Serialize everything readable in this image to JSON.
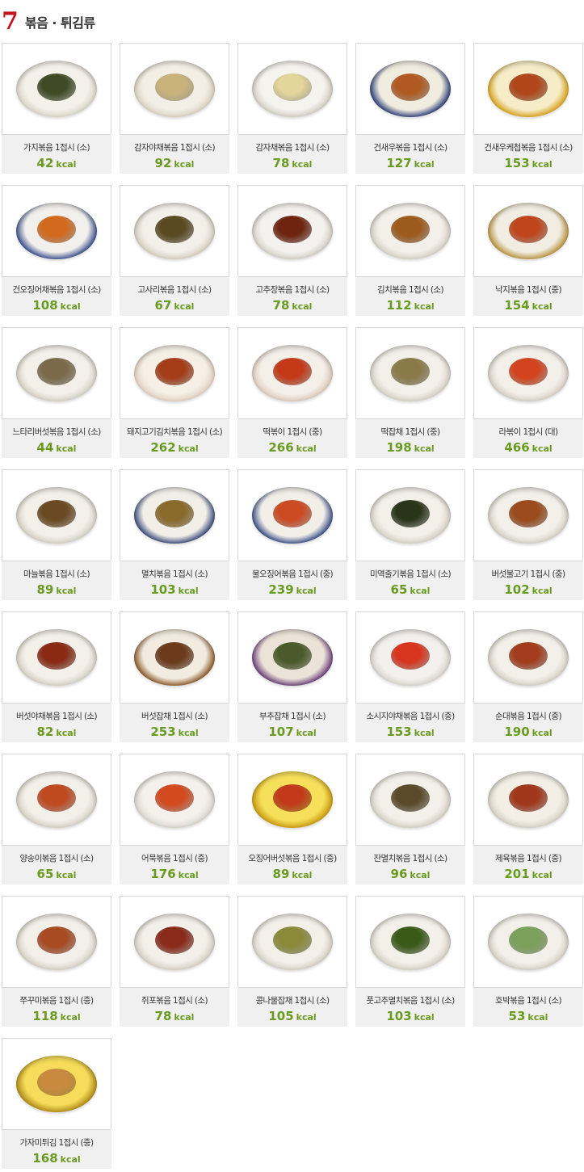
{
  "section": {
    "number": "7",
    "title": "볶음 · 튀김류"
  },
  "unit": "kcal",
  "items": [
    {
      "name": "가지볶음 1접시 (소)",
      "kcal": "42",
      "plate": "#f4f1ea",
      "rim": "#d9d3c6",
      "food": "#3f4a25"
    },
    {
      "name": "감자야채볶음 1접시 (소)",
      "kcal": "92",
      "plate": "#f3efe6",
      "rim": "#d8d0bf",
      "food": "#c9b37a"
    },
    {
      "name": "감자채볶음 1접시 (소)",
      "kcal": "78",
      "plate": "#f5f3ee",
      "rim": "#d2cdc2",
      "food": "#e4d59a"
    },
    {
      "name": "건새우볶음 1접시 (소)",
      "kcal": "127",
      "plate": "#f1ece0",
      "rim": "#2d3f78",
      "food": "#b05a22"
    },
    {
      "name": "건새우케첩볶음 1접시 (소)",
      "kcal": "153",
      "plate": "#f6ecc8",
      "rim": "#d8a21e",
      "food": "#b0461a"
    },
    {
      "name": "건오징어채볶음 1접시 (소)",
      "kcal": "108",
      "plate": "#f2f0ec",
      "rim": "#3a4f8c",
      "food": "#d26a1e"
    },
    {
      "name": "고사리볶음 1접시 (소)",
      "kcal": "67",
      "plate": "#f3f0ea",
      "rim": "#d4cdbf",
      "food": "#5a4a22"
    },
    {
      "name": "고추장볶음 1접시 (소)",
      "kcal": "78",
      "plate": "#f4f2ee",
      "rim": "#d3cec6",
      "food": "#6e2410"
    },
    {
      "name": "김치볶음 1접시 (소)",
      "kcal": "112",
      "plate": "#f3f0ea",
      "rim": "#d5cfc3",
      "food": "#9c5a1c"
    },
    {
      "name": "낙지볶음 1접시 (중)",
      "kcal": "154",
      "plate": "#f2ede2",
      "rim": "#b8933e",
      "food": "#c0451c"
    },
    {
      "name": "느타리버섯볶음 1접시 (소)",
      "kcal": "44",
      "plate": "#f3f0ea",
      "rim": "#d5cfc3",
      "food": "#7a6a4a"
    },
    {
      "name": "돼지고기김치볶음 1접시 (소)",
      "kcal": "262",
      "plate": "#f5efe6",
      "rim": "#e0cfc0",
      "food": "#a43c18"
    },
    {
      "name": "떡볶이 1접시 (중)",
      "kcal": "266",
      "plate": "#f4efe8",
      "rim": "#dcc9bb",
      "food": "#c43a18"
    },
    {
      "name": "떡잡채 1접시 (중)",
      "kcal": "198",
      "plate": "#f3f0ea",
      "rim": "#d5cfc3",
      "food": "#8a7a4a"
    },
    {
      "name": "라볶이 1접시 (대)",
      "kcal": "466",
      "plate": "#f3efe9",
      "rim": "#d6cec3",
      "food": "#d2431e"
    },
    {
      "name": "마늘볶음 1접시 (소)",
      "kcal": "89",
      "plate": "#f3f0ea",
      "rim": "#d5cfc3",
      "food": "#6a4a22"
    },
    {
      "name": "멸치볶음 1접시 (소)",
      "kcal": "103",
      "plate": "#f1efe8",
      "rim": "#3a4a7a",
      "food": "#8a6a2a"
    },
    {
      "name": "물오징어볶음 1접시 (중)",
      "kcal": "239",
      "plate": "#f2efe9",
      "rim": "#3b4f86",
      "food": "#cc4a22"
    },
    {
      "name": "미역줄기볶음 1접시 (소)",
      "kcal": "65",
      "plate": "#f3f0ea",
      "rim": "#d5cfc3",
      "food": "#2a3418"
    },
    {
      "name": "버섯불고기 1접시 (중)",
      "kcal": "102",
      "plate": "#f3f0ea",
      "rim": "#d5cfc3",
      "food": "#9a4a1c"
    },
    {
      "name": "버섯야채볶음 1접시 (소)",
      "kcal": "82",
      "plate": "#f3f0ea",
      "rim": "#d5cfc3",
      "food": "#8a2a14"
    },
    {
      "name": "버섯잡채 1접시 (소)",
      "kcal": "253",
      "plate": "#f2ebdf",
      "rim": "#8a5a2a",
      "food": "#6a3a1a"
    },
    {
      "name": "부추잡채 1접시 (소)",
      "kcal": "107",
      "plate": "#ece3d8",
      "rim": "#6a3f7a",
      "food": "#4a5a2a"
    },
    {
      "name": "소시지야채볶음 1접시 (중)",
      "kcal": "153",
      "plate": "#f3f1ee",
      "rim": "#d8d3cc",
      "food": "#d8351e"
    },
    {
      "name": "순대볶음 1접시 (중)",
      "kcal": "190",
      "plate": "#f3f0ea",
      "rim": "#d5cfc3",
      "food": "#a23c1c"
    },
    {
      "name": "양송이볶음 1접시 (소)",
      "kcal": "65",
      "plate": "#f3efe9",
      "rim": "#d5cfc3",
      "food": "#c04a20"
    },
    {
      "name": "어묵볶음 1접시 (중)",
      "kcal": "176",
      "plate": "#f4f1ec",
      "rim": "#d8d3cc",
      "food": "#d24a1e"
    },
    {
      "name": "오징어버섯볶음 1접시 (중)",
      "kcal": "89",
      "plate": "#f6df5a",
      "rim": "#c99a12",
      "food": "#c23a1a"
    },
    {
      "name": "잔멸치볶음 1접시 (소)",
      "kcal": "96",
      "plate": "#f3f0ea",
      "rim": "#d5cfc3",
      "food": "#5a4a2a"
    },
    {
      "name": "제육볶음 1접시 (중)",
      "kcal": "201",
      "plate": "#f3efe6",
      "rim": "#d5cfc3",
      "food": "#a0361a"
    },
    {
      "name": "쭈꾸미볶음 1접시 (중)",
      "kcal": "118",
      "plate": "#f3efe9",
      "rim": "#d5cfc3",
      "food": "#a84a22"
    },
    {
      "name": "쥐포볶음 1접시 (소)",
      "kcal": "78",
      "plate": "#f3f0ea",
      "rim": "#d5cfc3",
      "food": "#8a2a1a"
    },
    {
      "name": "콩나물잡채 1접시 (소)",
      "kcal": "105",
      "plate": "#f3f0ea",
      "rim": "#d5cfc3",
      "food": "#8a8a3a"
    },
    {
      "name": "풋고추멸치볶음 1접시 (소)",
      "kcal": "103",
      "plate": "#f3f0ea",
      "rim": "#d5cfc3",
      "food": "#3a5a1a"
    },
    {
      "name": "호박볶음 1접시 (소)",
      "kcal": "53",
      "plate": "#f3f0ea",
      "rim": "#d5cfc3",
      "food": "#7aa05a"
    },
    {
      "name": "가자미튀김 1접시 (중)",
      "kcal": "168",
      "plate": "#f6dc5a",
      "rim": "#b08a1a",
      "food": "#c98a40"
    }
  ]
}
